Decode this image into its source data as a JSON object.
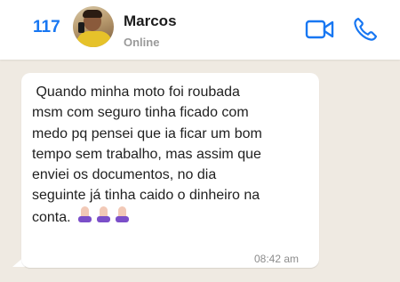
{
  "header": {
    "back_count": "117",
    "contact_name": "Marcos",
    "status": "Online",
    "accent_color": "#1877f2",
    "icons": [
      "video-call-icon",
      "phone-call-icon"
    ]
  },
  "message": {
    "text": " Quando minha moto foi roubada\nmsm com seguro tinha ficado com\nmedo pq pensei que ia ficar um bom\ntempo sem trabalho, mas assim que\nenviei os documentos, no dia\nseguinte já tinha caido o dinheiro na\nconta. ",
    "emoji": "praying-hands x3",
    "time": "08:42 am"
  }
}
